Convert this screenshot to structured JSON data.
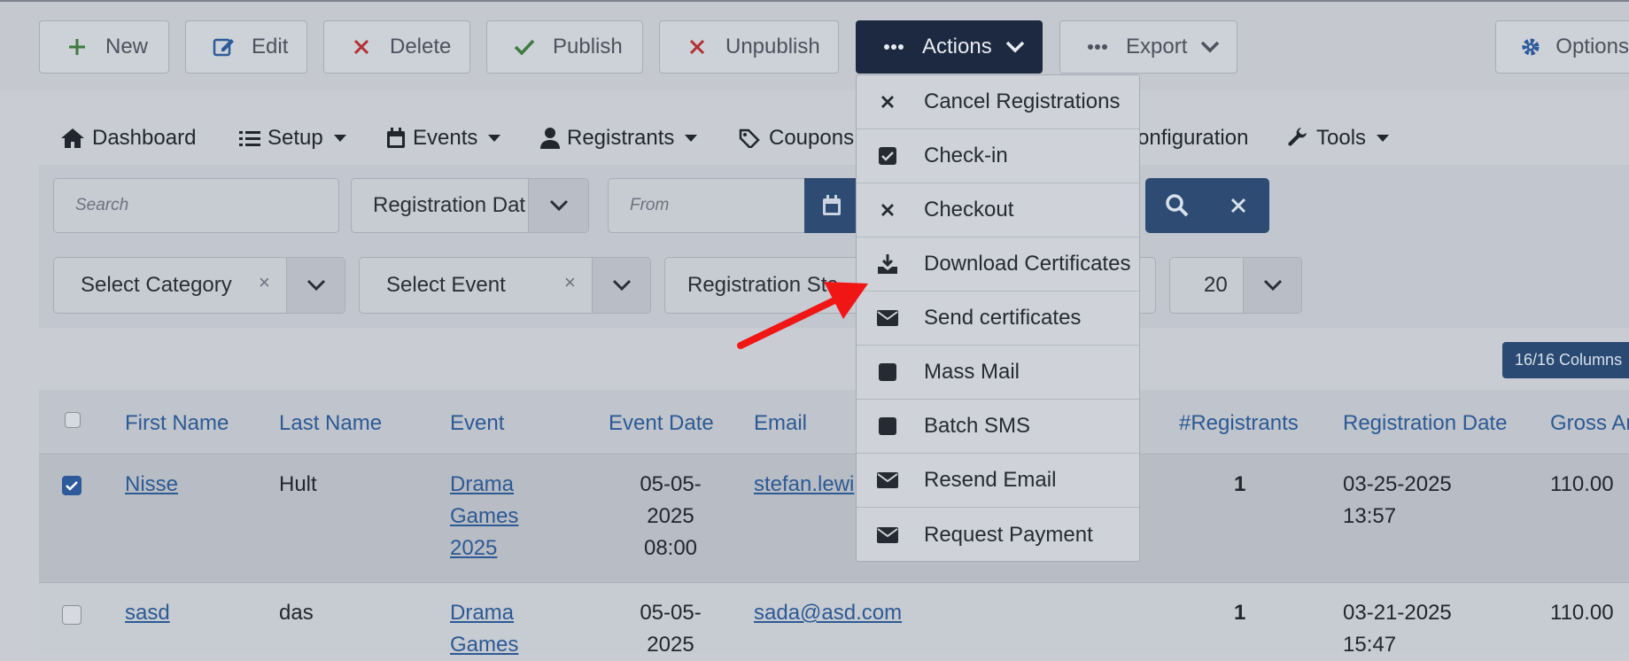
{
  "toolbar": {
    "new_label": "New",
    "edit_label": "Edit",
    "delete_label": "Delete",
    "publish_label": "Publish",
    "unpublish_label": "Unpublish",
    "actions_label": "Actions",
    "export_label": "Export",
    "options_label": "Options"
  },
  "nav": {
    "dashboard": "Dashboard",
    "setup": "Setup",
    "events": "Events",
    "registrants": "Registrants",
    "coupons": "Coupons",
    "configuration": "onfiguration",
    "tools": "Tools"
  },
  "filters": {
    "search_placeholder": "Search",
    "date_type": "Registration Dat",
    "from_placeholder": "From",
    "category": "Select Category",
    "event": "Select Event",
    "status": "Registration Sta",
    "limit": "20",
    "clear_x": "×"
  },
  "columns_badge": "16/16 Columns",
  "table": {
    "headers": {
      "first_name": "First Name",
      "last_name": "Last Name",
      "event": "Event",
      "event_date": "Event Date",
      "email": "Email",
      "registrants": "#Registrants",
      "registration_date": "Registration Date",
      "gross": "Gross Ar"
    },
    "rows": [
      {
        "first_name": "Nisse",
        "last_name": "Hult",
        "event_l1": "Drama",
        "event_l2": "Games",
        "event_l3": "2025",
        "date_l1": "05-05-",
        "date_l2": "2025",
        "date_l3": "08:00",
        "email": "stefan.lewi",
        "registrants": "1",
        "reg_l1": "03-25-2025",
        "reg_l2": "13:57",
        "gross": "110.00",
        "checked": true
      },
      {
        "first_name": "sasd",
        "last_name": "das",
        "event_l1": "Drama",
        "event_l2": "Games",
        "date_l1": "05-05-",
        "date_l2": "2025",
        "email": "sada@asd.com",
        "registrants": "1",
        "reg_l1": "03-21-2025",
        "reg_l2": "15:47",
        "gross": "110.00",
        "checked": false
      }
    ]
  },
  "actions_menu": {
    "items": [
      {
        "label": "Cancel Registrations",
        "icon": "times-icon"
      },
      {
        "label": "Check-in",
        "icon": "check-square-icon"
      },
      {
        "label": "Checkout",
        "icon": "times-icon"
      },
      {
        "label": "Download Certificates",
        "icon": "download-icon"
      },
      {
        "label": "Send certificates",
        "icon": "envelope-icon"
      },
      {
        "label": "Mass Mail",
        "icon": "square-icon"
      },
      {
        "label": "Batch SMS",
        "icon": "square-icon"
      },
      {
        "label": "Resend Email",
        "icon": "envelope-icon"
      },
      {
        "label": "Request Payment",
        "icon": "envelope-icon"
      }
    ]
  },
  "colors": {
    "link": "#2c5a94",
    "dark_button": "#1c2940",
    "annotation_arrow": "#f01616"
  }
}
